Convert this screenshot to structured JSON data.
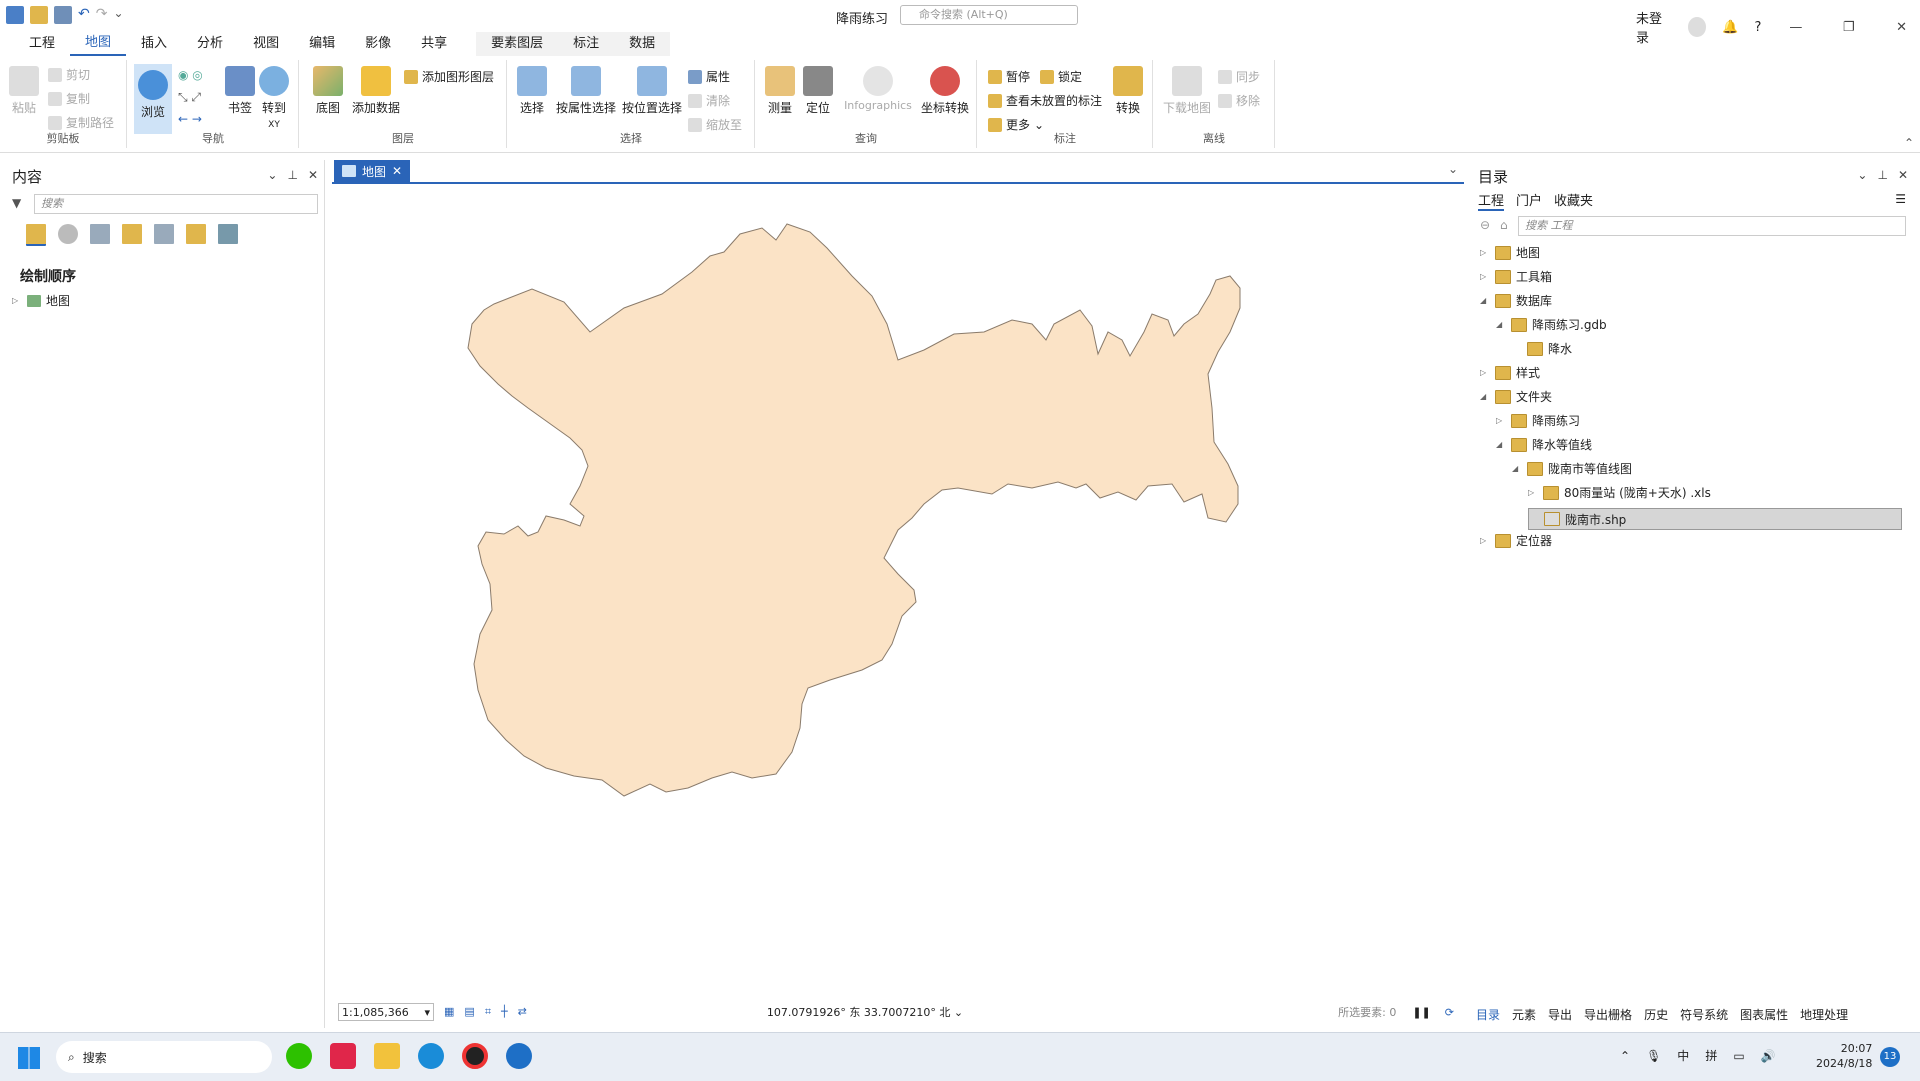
{
  "app": {
    "title": "降雨练习",
    "search_placeholder": "命令搜索 (Alt+Q)",
    "user": "未登录",
    "help": "?"
  },
  "ribbon": {
    "tabs": [
      "工程",
      "地图",
      "插入",
      "分析",
      "视图",
      "编辑",
      "影像",
      "共享"
    ],
    "context_tabs": [
      "要素图层",
      "标注",
      "数据"
    ],
    "clipboard": {
      "label": "剪贴板",
      "paste": "粘贴",
      "cut": "剪切",
      "copy": "复制",
      "copy_path": "复制路径"
    },
    "navigate": {
      "label": "导航",
      "explore": "浏览",
      "bookmarks": "书签",
      "goto": "转到",
      "goto_sub": "XY"
    },
    "layer": {
      "label": "图层",
      "basemap": "底图",
      "add_data": "添加数据",
      "add_graphics": "添加图形图层"
    },
    "selection": {
      "label": "选择",
      "select": "选择",
      "by_attr": "按属性选择",
      "by_loc": "按位置选择",
      "attributes": "属性",
      "clear": "清除",
      "zoom_to": "缩放至"
    },
    "inquiry": {
      "label": "查询",
      "measure": "测量",
      "locate": "定位",
      "infographics": "Infographics",
      "coord": "坐标转换"
    },
    "labeling": {
      "label": "标注",
      "pause": "暂停",
      "lock": "锁定",
      "view_unplaced": "查看未放置的标注",
      "more": "更多",
      "convert": "转换"
    },
    "offline": {
      "label": "离线",
      "download": "下载地图",
      "sync": "同步",
      "remove": "移除"
    }
  },
  "contents": {
    "title": "内容",
    "search": "搜索",
    "draw_order": "绘制顺序",
    "items": [
      "地图"
    ]
  },
  "map": {
    "tab": "地图",
    "scale": "1:1,085,366",
    "coords": "107.0791926° 东 33.7007210° 北",
    "selected": "所选要素: 0"
  },
  "catalog": {
    "title": "目录",
    "tabs": [
      "工程",
      "门户",
      "收藏夹"
    ],
    "search": "搜索 工程",
    "tree": [
      {
        "label": "地图",
        "level": 0,
        "state": "collapsed"
      },
      {
        "label": "工具箱",
        "level": 0,
        "state": "collapsed"
      },
      {
        "label": "数据库",
        "level": 0,
        "state": "expanded"
      },
      {
        "label": "降雨练习.gdb",
        "level": 1,
        "state": "expanded"
      },
      {
        "label": "降水",
        "level": 2,
        "state": "none"
      },
      {
        "label": "样式",
        "level": 0,
        "state": "collapsed"
      },
      {
        "label": "文件夹",
        "level": 0,
        "state": "expanded"
      },
      {
        "label": "降雨练习",
        "level": 1,
        "state": "collapsed"
      },
      {
        "label": "降水等值线",
        "level": 1,
        "state": "expanded"
      },
      {
        "label": "陇南市等值线图",
        "level": 2,
        "state": "expanded"
      },
      {
        "label": "80雨量站 (陇南+天水) .xls",
        "level": 3,
        "state": "collapsed"
      },
      {
        "label": "陇南市.shp",
        "level": 3,
        "state": "selected"
      },
      {
        "label": "定位器",
        "level": 0,
        "state": "collapsed"
      }
    ],
    "bottom_tabs": [
      "目录",
      "元素",
      "导出",
      "导出栅格",
      "历史",
      "符号系统",
      "图表属性",
      "地理处理"
    ]
  },
  "taskbar": {
    "search": "搜索",
    "ime1": "中",
    "ime2": "拼",
    "time": "20:07",
    "date": "2024/8/18",
    "badge": "13"
  },
  "colors": {
    "accent": "#2a64b8",
    "polygon": "#fbe3c6",
    "polygon_stroke": "#8a7b6b"
  }
}
